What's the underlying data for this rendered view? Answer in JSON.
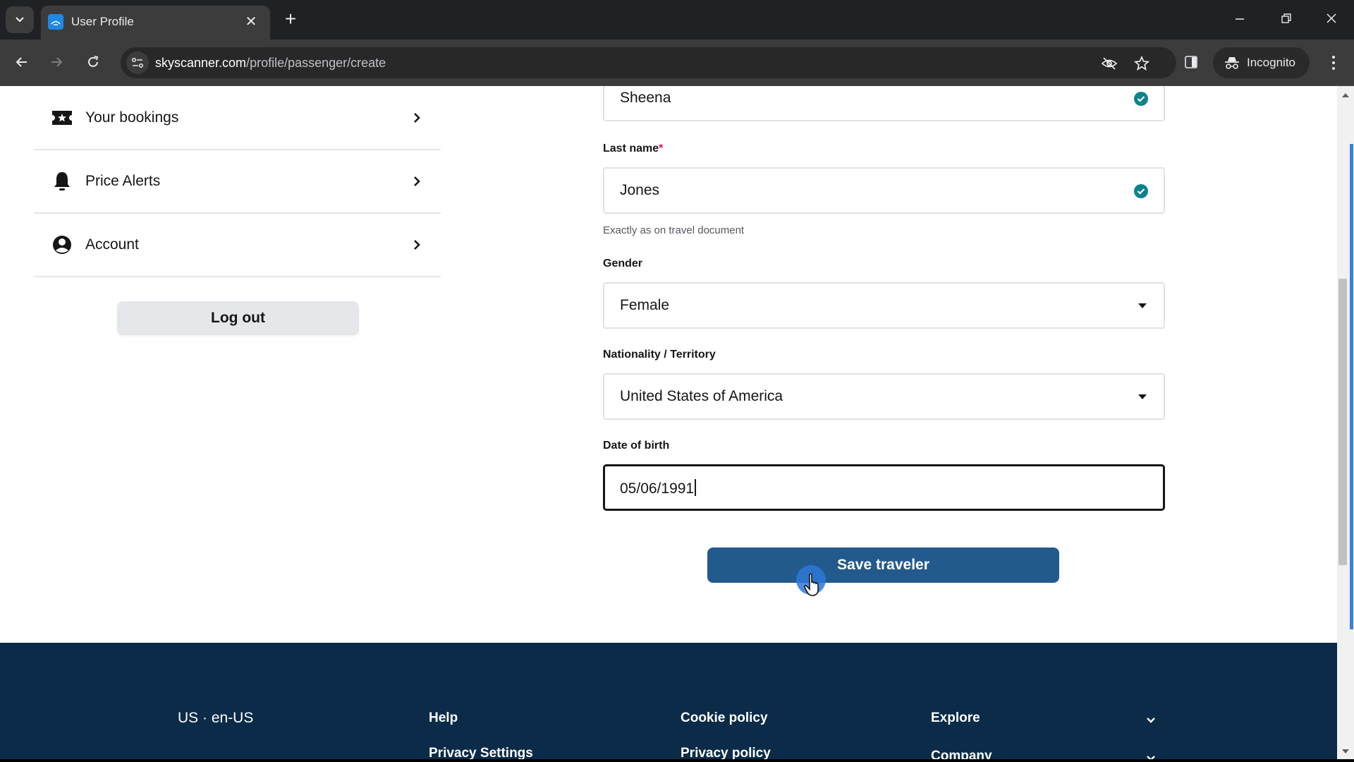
{
  "browser": {
    "tab_title": "User Profile",
    "url_host": "skyscanner.com",
    "url_path": "/profile/passenger/create",
    "incognito_label": "Incognito"
  },
  "sidebar": {
    "items": [
      {
        "label": "Your bookings",
        "icon": "ticket-star-icon"
      },
      {
        "label": "Price Alerts",
        "icon": "bell-icon"
      },
      {
        "label": "Account",
        "icon": "account-circle-icon"
      }
    ],
    "logout_label": "Log out"
  },
  "form": {
    "first_name": {
      "value": "Sheena",
      "valid": true
    },
    "last_name": {
      "label": "Last name",
      "required_mark": "*",
      "value": "Jones",
      "valid": true,
      "helper": "Exactly as on travel document"
    },
    "gender": {
      "label": "Gender",
      "value": "Female"
    },
    "nationality": {
      "label": "Nationality / Territory",
      "value": "United States of America"
    },
    "dob": {
      "label": "Date of birth",
      "value": "05/06/1991"
    },
    "save_label": "Save traveler"
  },
  "footer": {
    "locale": "US · en-US",
    "col1": [
      "Help",
      "Privacy Settings"
    ],
    "col2": [
      "Cookie policy",
      "Privacy policy"
    ],
    "col3": [
      "Explore",
      "Company"
    ]
  },
  "colors": {
    "primary_button": "#235a8d",
    "valid_check": "#0c838a",
    "footer_bg": "#0b2b48",
    "required": "#e70866"
  }
}
